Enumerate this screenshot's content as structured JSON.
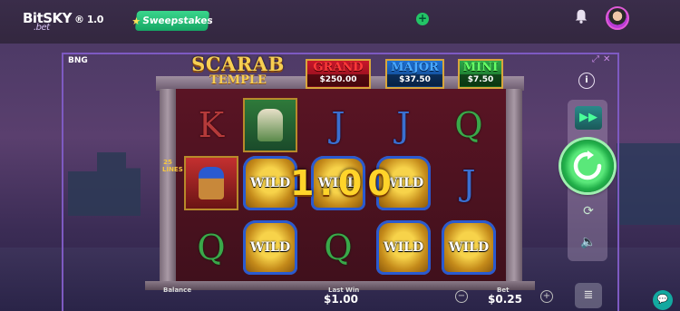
{
  "header": {
    "logo_main": "BitSKY",
    "logo_sub": ".bet",
    "logo_version": "® 1.0",
    "sweep_label": "Sweepstakes"
  },
  "game": {
    "provider": "BNG",
    "title_line1": "SCARAB",
    "title_line2": "TEMPLE",
    "lines_label": "25 LINES",
    "jackpots": {
      "grand": {
        "label": "GRAND",
        "value": "$250.00"
      },
      "major": {
        "label": "MAJOR",
        "value": "$37.50"
      },
      "mini": {
        "label": "MINI",
        "value": "$7.50"
      }
    },
    "win_amount": "1.00",
    "wild_label": "WILD",
    "grid": [
      [
        "K",
        "horus",
        "J",
        "J",
        "Q"
      ],
      [
        "nefertiti",
        "WILD",
        "WILD",
        "WILD",
        "J"
      ],
      [
        "Q",
        "WILD",
        "Q",
        "WILD",
        "WILD"
      ]
    ]
  },
  "bottom": {
    "balance_label": "Balance",
    "balance_value": "",
    "lastwin_label": "Last Win",
    "lastwin_value": "$1.00",
    "bet_label": "Bet",
    "bet_value": "$0.25"
  },
  "colors": {
    "accent_green": "#22b04a",
    "frame_purple": "#7e5ac2",
    "gold": "#f7cf52"
  }
}
